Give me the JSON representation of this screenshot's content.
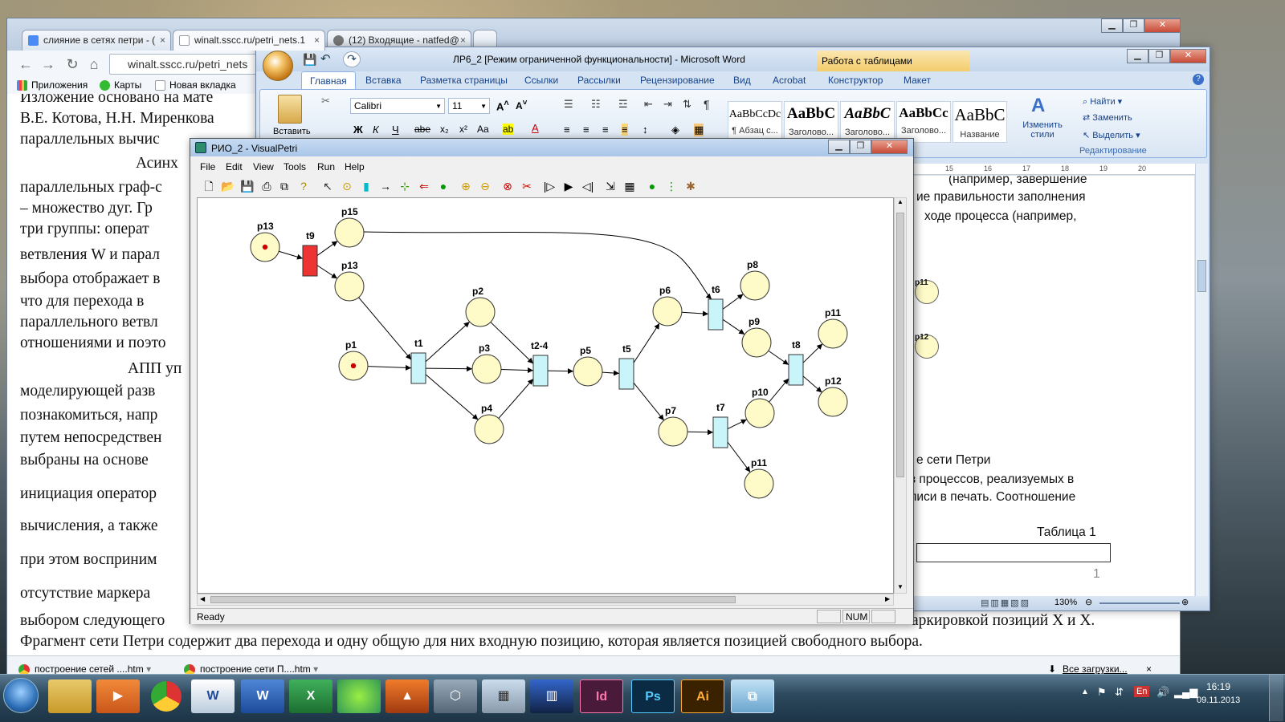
{
  "chrome": {
    "tabs": [
      {
        "title": "слияние в сетях петри - (",
        "close": "×"
      },
      {
        "title": "winalt.sscc.ru/petri_nets.1",
        "close": "×"
      },
      {
        "title": "(12) Входящие - natfed@",
        "close": "×"
      }
    ],
    "url": "winalt.sscc.ru/petri_nets",
    "bookmarks": [
      "Приложения",
      "Карты",
      "Новая вкладка"
    ],
    "doc_lines": [
      "Изложение основано на мате",
      "В.Е. Котова, Н.Н. Миренкова",
      "параллельных вычис",
      "Асинх",
      "параллельных граф-с",
      "– множество дуг. Гр",
      "три группы: операт",
      "ветвления W и парал",
      "выбора отображает в",
      "что для перехода в",
      "параллельного ветвл",
      "отношениями и поэто",
      "АПП уп",
      "моделирующей разв",
      "познакомиться, напр",
      "путем непосредствен",
      "выбраны на основе",
      "инициация оператор",
      "вычисления, а также",
      "при этом восприним",
      "отсутствие маркера",
      "выбором следующего",
      "Фрагмент сети Петри содержит два перехода и одну общую для них входную позицию, которая является позицией свободного выбора."
    ],
    "doc_right_fragment": "аркировкой позиций X и X.",
    "downloads": [
      "построение сетей ....htm",
      "построение сети П....htm"
    ],
    "all_downloads": "Все загрузки...",
    "dl_close": "×"
  },
  "word": {
    "title": "ЛР6_2 [Режим ограниченной функциональности] - Microsoft Word",
    "context_tab": "Работа с таблицами",
    "tabs": [
      "Главная",
      "Вставка",
      "Разметка страницы",
      "Ссылки",
      "Рассылки",
      "Рецензирование",
      "Вид",
      "Acrobat",
      "Конструктор",
      "Макет"
    ],
    "font_name": "Calibri",
    "font_size": "11",
    "paste_label": "Вставить",
    "styles": [
      {
        "sample": "AaBbCcDc",
        "name": "¶ Абзац с..."
      },
      {
        "sample": "AaBbC",
        "name": "Заголово..."
      },
      {
        "sample": "AaBbC",
        "name": "Заголово..."
      },
      {
        "sample": "AaBbCc",
        "name": "Заголово..."
      },
      {
        "sample": "AaBbC",
        "name": "Название"
      }
    ],
    "change_styles": "Изменить стили",
    "find": "Найти",
    "replace": "Заменить",
    "select": "Выделить",
    "editing_group": "Редактирование",
    "ruler_marks": [
      "15",
      "16",
      "17",
      "18",
      "19",
      "20"
    ],
    "page_lines": [
      "(например, завершение",
      "ие правильности заполнения",
      "ходе процесса (например,",
      "е сети Петри",
      "з процессов, реализуемых в",
      "писи в печать. Соотношение"
    ],
    "side_labels": [
      "p11",
      "p12"
    ],
    "table_caption": "Таблица 1",
    "page_number": "1",
    "zoom": "130%"
  },
  "visualpetri": {
    "title": "РИО_2 - VisualPetri",
    "menu": [
      "File",
      "Edit",
      "View",
      "Tools",
      "Run",
      "Help"
    ],
    "status": "Ready",
    "num": "NUM",
    "places": [
      {
        "id": "p13",
        "label": "p13",
        "marked": true
      },
      {
        "id": "p15",
        "label": "p15",
        "marked": false
      },
      {
        "id": "p13b",
        "label": "p13",
        "marked": false
      },
      {
        "id": "p1",
        "label": "p1",
        "marked": true
      },
      {
        "id": "p2",
        "label": "p2",
        "marked": false
      },
      {
        "id": "p3",
        "label": "p3",
        "marked": false
      },
      {
        "id": "p4",
        "label": "p4",
        "marked": false
      },
      {
        "id": "p5",
        "label": "p5",
        "marked": false
      },
      {
        "id": "p6",
        "label": "p6",
        "marked": false
      },
      {
        "id": "p7",
        "label": "p7",
        "marked": false
      },
      {
        "id": "p8",
        "label": "p8",
        "marked": false
      },
      {
        "id": "p9",
        "label": "p9",
        "marked": false
      },
      {
        "id": "p10",
        "label": "p10",
        "marked": false
      },
      {
        "id": "p11",
        "label": "p11",
        "marked": false
      },
      {
        "id": "p11b",
        "label": "p11",
        "marked": false
      },
      {
        "id": "p12",
        "label": "p12",
        "marked": false
      }
    ],
    "transitions": [
      {
        "id": "t9",
        "label": "t9",
        "enabled": true
      },
      {
        "id": "t1",
        "label": "t1",
        "enabled": false
      },
      {
        "id": "t24",
        "label": "t2-4",
        "enabled": false
      },
      {
        "id": "t5",
        "label": "t5",
        "enabled": false
      },
      {
        "id": "t6",
        "label": "t6",
        "enabled": false
      },
      {
        "id": "t7",
        "label": "t7",
        "enabled": false
      },
      {
        "id": "t8",
        "label": "t8",
        "enabled": false
      }
    ]
  },
  "taskbar": {
    "items": [
      "Explorer",
      "Media",
      "Chrome",
      "Word doc",
      "Word",
      "Excel",
      "Messenger",
      "Matlab",
      "Box",
      "Calculator",
      "Library",
      "InDesign",
      "Photoshop",
      "Illustrator",
      "VisualPetri"
    ],
    "labels": {
      "indesign": "Id",
      "photoshop": "Ps",
      "illustrator": "Ai",
      "word": "W"
    },
    "lang": "En",
    "time": "16:19",
    "date": "09.11.2013"
  },
  "colors": {
    "place_fill": "#fffbc8",
    "transition_fill": "#c8f4fa",
    "enabled_transition": "#ee3333",
    "token": "#cc0000"
  }
}
